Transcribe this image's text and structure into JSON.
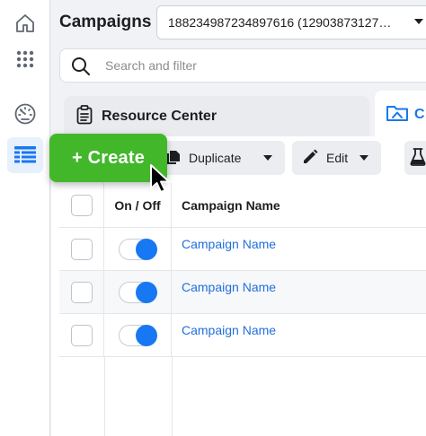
{
  "page": {
    "title": "Campaigns"
  },
  "account": {
    "selected": "188234987234897616 (12903873127…"
  },
  "search": {
    "placeholder": "Search and filter"
  },
  "tabs": [
    {
      "label": "Resource Center",
      "icon": "clipboard-icon"
    },
    {
      "label": "C",
      "icon": "folder-icon"
    }
  ],
  "toolbar": {
    "create_label": "+ Create",
    "duplicate_label": "Duplicate",
    "edit_label": "Edit",
    "lab_icon": "flask-icon"
  },
  "table": {
    "headers": {
      "toggle": "On / Off",
      "name": "Campaign Name"
    },
    "rows": [
      {
        "name": "Campaign Name",
        "on": true
      },
      {
        "name": "Campaign Name",
        "on": true
      },
      {
        "name": "Campaign Name",
        "on": true
      }
    ]
  },
  "colors": {
    "accent": "#1877f2",
    "create": "#42b72a",
    "link": "#216fdb"
  }
}
